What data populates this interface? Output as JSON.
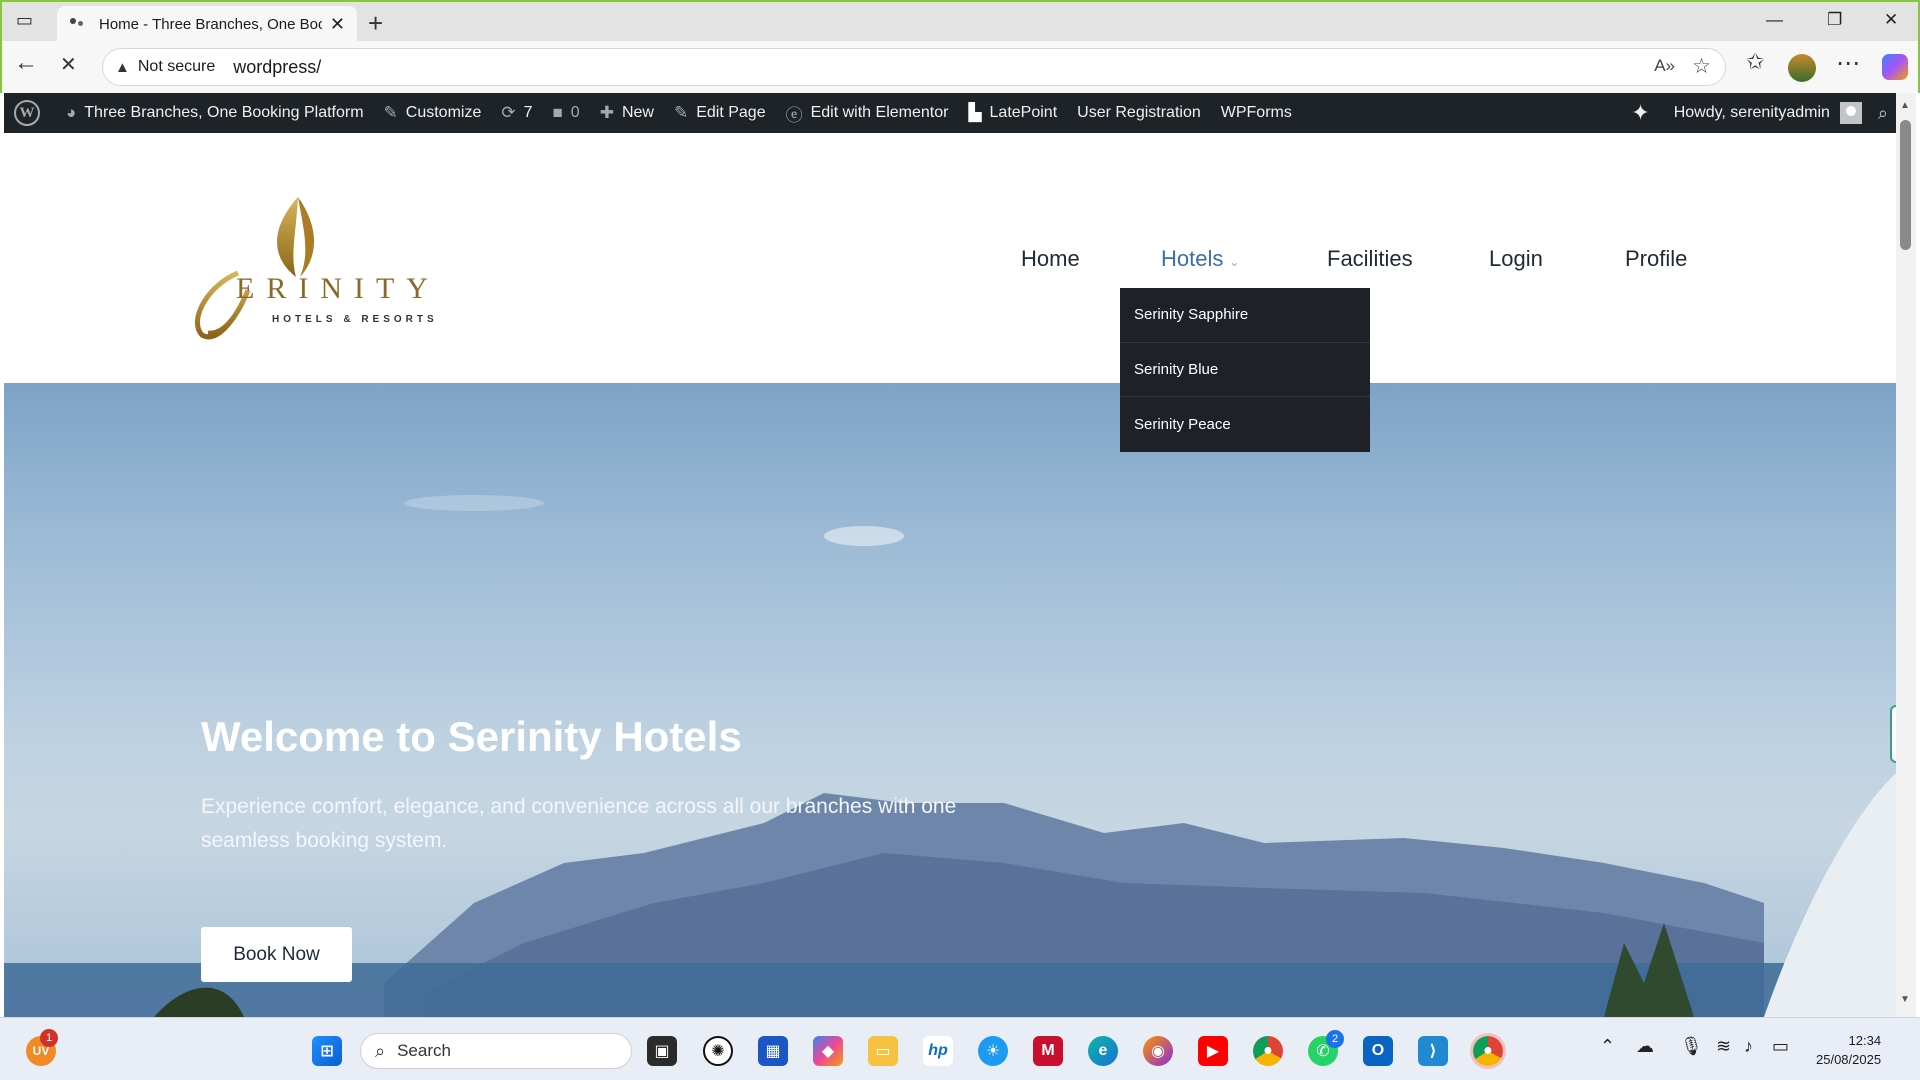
{
  "browser": {
    "tab_title": "Home - Three Branches, One Boo",
    "new_tab": "+",
    "security_label": "Not secure",
    "url": "wordpress/",
    "window_controls": [
      "minimize-icon",
      "restore-icon",
      "close-icon"
    ]
  },
  "wp_admin_bar": {
    "site_name": "Three Branches, One Booking Platform",
    "customize": "Customize",
    "updates_count": "7",
    "comments_count": "0",
    "new": "New",
    "edit_page": "Edit Page",
    "edit_elementor": "Edit with Elementor",
    "latepoint": "LatePoint",
    "user_registration": "User Registration",
    "wpforms": "WPForms",
    "howdy": "Howdy, serenityadmin"
  },
  "site": {
    "logo_text": "ERINITY",
    "logo_sub": "HOTELS & RESORTS",
    "menu": [
      "Home",
      "Hotels",
      "Facilities",
      "Login",
      "Profile"
    ],
    "hotels_dropdown": [
      "Serinity Sapphire",
      "Serinity Blue",
      "Serinity Peace"
    ]
  },
  "hero": {
    "title": "Welcome to Serinity Hotels",
    "subtitle": "Experience comfort, elegance, and convenience across all our branches with one seamless booking system.",
    "button": "Book Now"
  },
  "taskbar": {
    "search_placeholder": "Search",
    "weather_badge": "1",
    "weather_label": "UV",
    "whatsapp_badge": "2",
    "time": "12:34",
    "date": "25/08/2025"
  },
  "colors": {
    "accent_green": "#86c542",
    "wp_bar": "#1d2327",
    "menu_active": "#3a6ea5",
    "dropdown_bg": "#1e2127"
  }
}
